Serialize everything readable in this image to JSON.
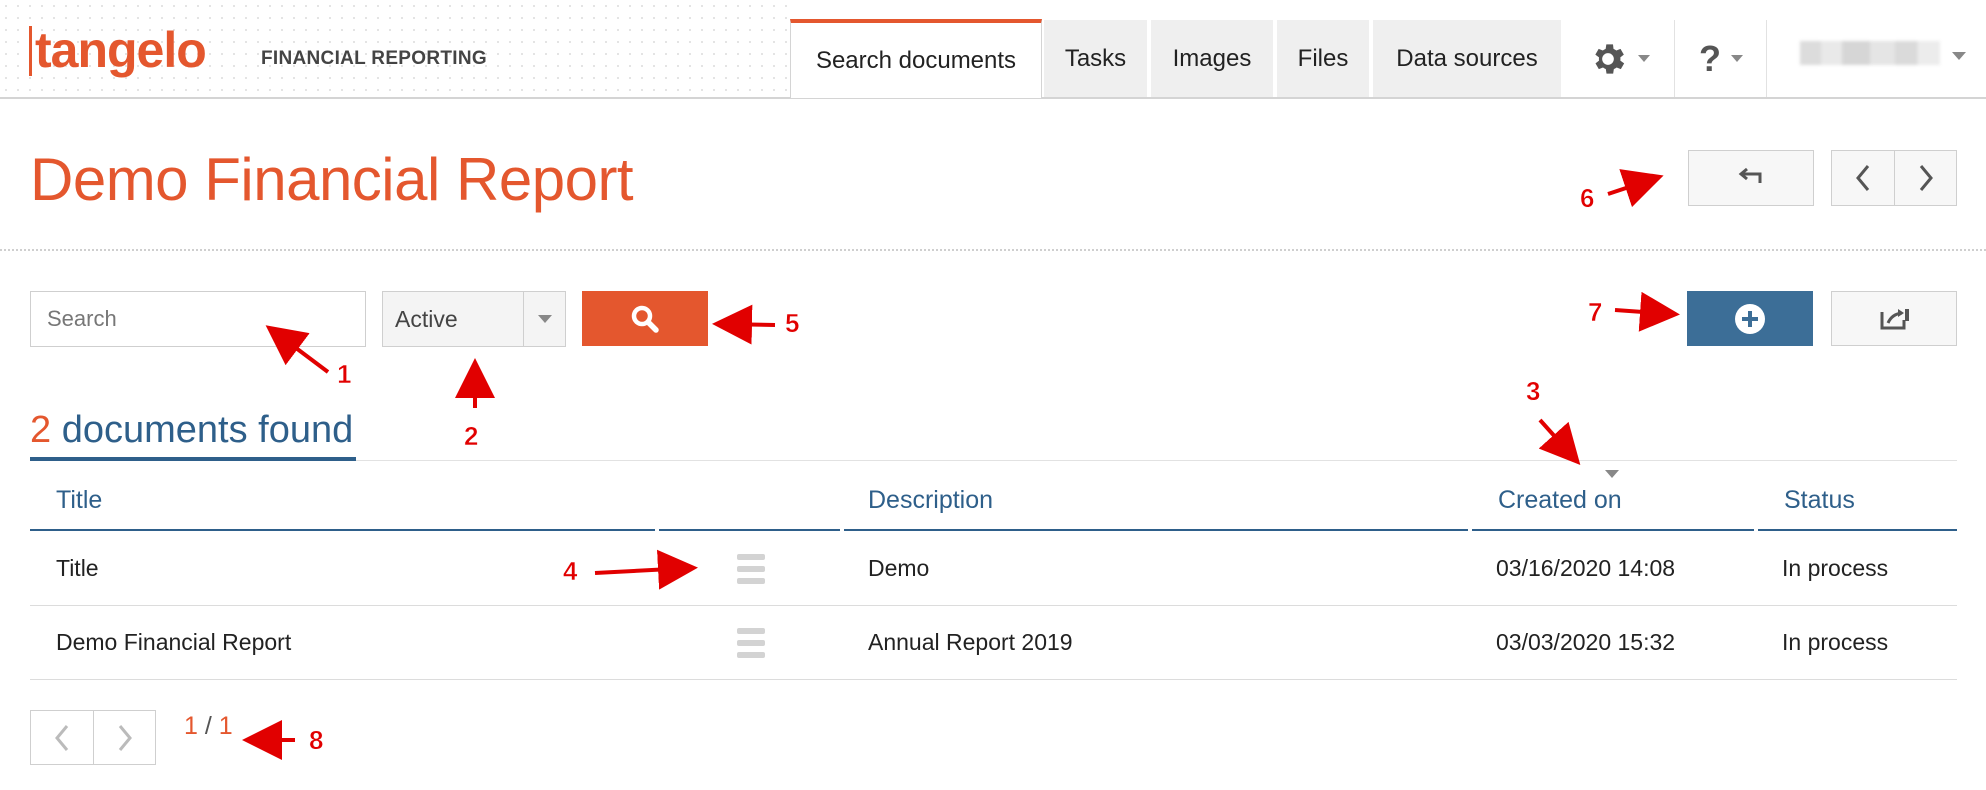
{
  "brand": {
    "logo": "tangelo",
    "product": "FINANCIAL REPORTING",
    "accent_color": "#e4572e",
    "link_color": "#2e5f8a",
    "primary_button_color": "#3c6e97"
  },
  "nav": {
    "tabs": [
      {
        "label": "Search documents",
        "active": true
      },
      {
        "label": "Tasks",
        "active": false
      },
      {
        "label": "Images",
        "active": false
      },
      {
        "label": "Files",
        "active": false
      },
      {
        "label": "Data sources",
        "active": false
      }
    ],
    "settings_icon": "gear-icon",
    "help_icon": "question-icon",
    "help_label": "?"
  },
  "page": {
    "title": "Demo Financial Report"
  },
  "toolbar": {
    "search_placeholder": "Search",
    "search_value": "",
    "status_filter": "Active"
  },
  "results": {
    "count": "2",
    "label": "documents found"
  },
  "table": {
    "columns": [
      "Title",
      "Description",
      "Created on",
      "Status"
    ],
    "rows": [
      {
        "title": "Title",
        "description": "Demo",
        "created_on": "03/16/2020 14:08",
        "status": "In process"
      },
      {
        "title": "Demo Financial Report",
        "description": "Annual Report 2019",
        "created_on": "03/03/2020 15:32",
        "status": "In process"
      }
    ]
  },
  "pager": {
    "current": "1",
    "separator": "/",
    "total": "1"
  },
  "annotations": [
    "1",
    "2",
    "3",
    "4",
    "5",
    "6",
    "7",
    "8"
  ]
}
